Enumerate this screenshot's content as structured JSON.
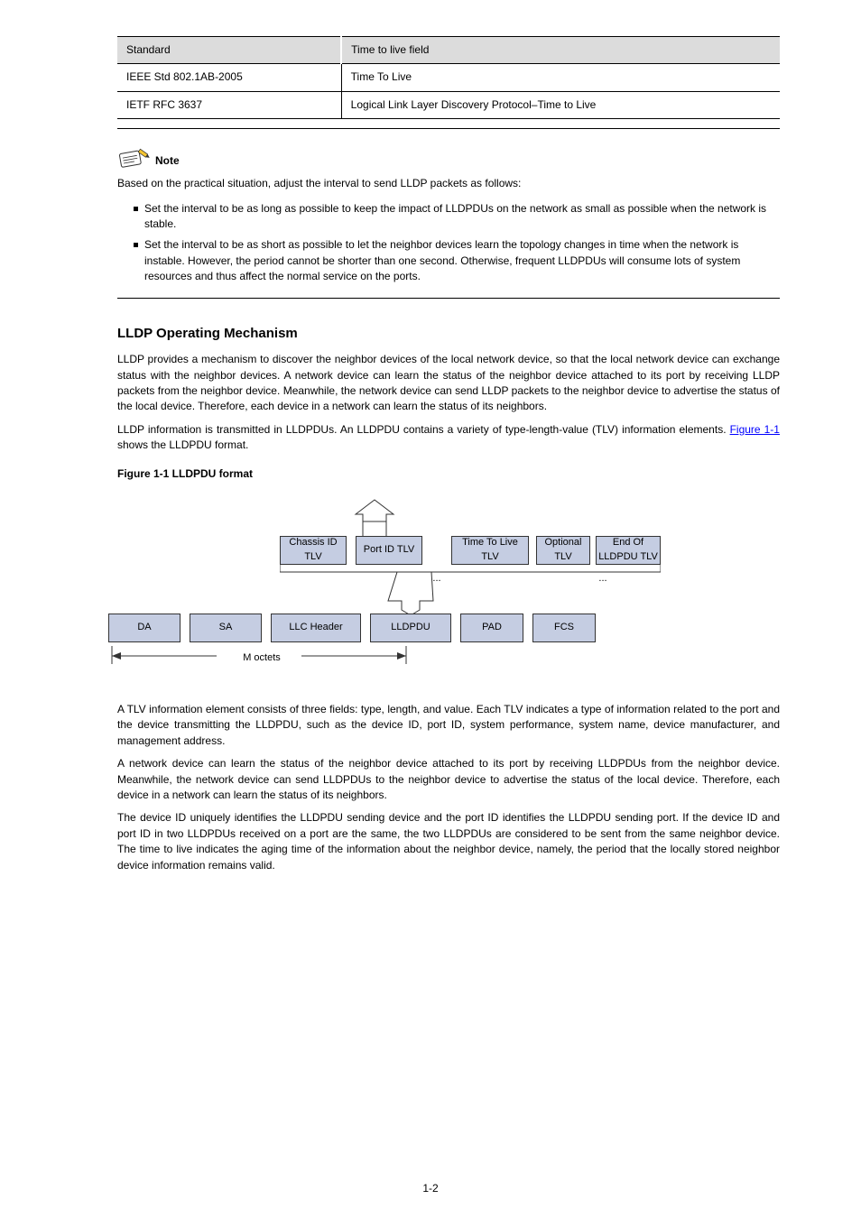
{
  "table": {
    "head": {
      "col1": "Standard",
      "col2": "Time to live field"
    },
    "rows": [
      {
        "std": "IEEE Std 802.1AB-2005",
        "ttl": "Time To Live"
      },
      {
        "std": "IETF RFC 3637",
        "ttl": "Logical Link Layer Discovery Protocol–Time to Live"
      }
    ]
  },
  "note": {
    "label": "Note",
    "intro": "Based on the practical situation, adjust the interval to send LLDP packets as follows:",
    "bullets": [
      "Set the interval to be as long as possible to keep the impact of LLDPDUs on the network as small as possible when the network is stable.",
      "Set the interval to be as short as possible to let the neighbor devices learn the topology changes in time when the network is instable. However, the period cannot be shorter than one second. Otherwise, frequent LLDPDUs will consume lots of system resources and thus affect the normal service on the ports."
    ]
  },
  "section": {
    "heading": "LLDP Operating Mechanism",
    "p1": "LLDP provides a mechanism to discover the neighbor devices of the local network device, so that the local network device can exchange status with the neighbor devices. A network device can learn the status of the neighbor device attached to its port by receiving LLDP packets from the neighbor device. Meanwhile, the network device can send LLDP packets to the neighbor device to advertise the status of the local device. Therefore, each device in a network can learn the status of its neighbors.",
    "p2a": "LLDP information is transmitted in LLDPDUs. An LLDPDU contains a variety of type-length-value (TLV) information elements. ",
    "p2b": " shows the LLDPDU format.",
    "figref": "Figure 1-1"
  },
  "figure": {
    "caption": "Figure 1-1 LLDPDU format",
    "boxes_top": {
      "chassis": "Chassis ID TLV",
      "port": "Port ID TLV",
      "ttl": "Time To Live TLV",
      "opt": "Optional TLV",
      "eol": "End Of LLDPDU TLV"
    },
    "boxes_bot": {
      "da": "DA",
      "sa": "SA",
      "llc": "LLC Header",
      "lldpdu": "LLDPDU",
      "pad": "PAD",
      "fcs": "FCS"
    },
    "dots": "...",
    "m": "M octets",
    "post": {
      "p1": "A TLV information element consists of three fields: type, length, and value. Each TLV indicates a type of information related to the port and the device transmitting the LLDPDU, such as the device ID, port ID, system performance, system name, device manufacturer, and management address.",
      "p2": "A network device can learn the status of the neighbor device attached to its port by receiving LLDPDUs from the neighbor device. Meanwhile, the network device can send LLDPDUs to the neighbor device to advertise the status of the local device. Therefore, each device in a network can learn the status of its neighbors.",
      "p3": "The device ID uniquely identifies the LLDPDU sending device and the port ID identifies the LLDPDU sending port. If the device ID and port ID in two LLDPDUs received on a port are the same, the two LLDPDUs are considered to be sent from the same neighbor device. The time to live indicates the aging time of the information about the neighbor device, namely, the period that the locally stored neighbor device information remains valid."
    }
  },
  "page_number": "1-2"
}
